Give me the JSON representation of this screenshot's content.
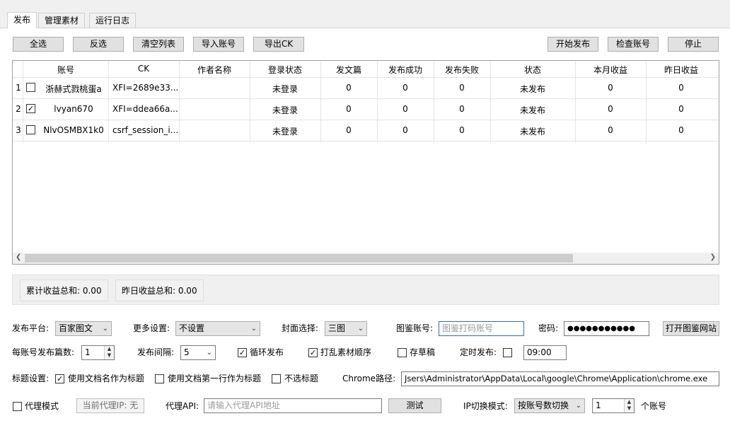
{
  "tabs": [
    {
      "label": "发布"
    },
    {
      "label": "管理素材"
    },
    {
      "label": "运行日志"
    }
  ],
  "toolbar": {
    "select_all": "全选",
    "invert": "反选",
    "clear_list": "清空列表",
    "import_accounts": "导入账号",
    "export_ck": "导出CK",
    "start_publish": "开始发布",
    "check_accounts": "检查账号",
    "stop": "停止"
  },
  "table": {
    "headers": [
      "账号",
      "CK",
      "作者名称",
      "登录状态",
      "发文篇",
      "发布成功",
      "发布失败",
      "状态",
      "本月收益",
      "昨日收益"
    ],
    "rows": [
      {
        "num": "1",
        "checked": false,
        "account": "浙赫式戮桃蛋a",
        "ck": "XFI=2689e33...",
        "author": "",
        "login": "未登录",
        "posts": "0",
        "success": "0",
        "fail": "0",
        "status": "未发布",
        "month": "0",
        "yesterday": "0"
      },
      {
        "num": "2",
        "checked": true,
        "account": "lvyan670",
        "ck": "XFI=ddea66a...",
        "author": "",
        "login": "未登录",
        "posts": "0",
        "success": "0",
        "fail": "0",
        "status": "未发布",
        "month": "0",
        "yesterday": "0"
      },
      {
        "num": "3",
        "checked": false,
        "account": "NlvOSMBX1k0",
        "ck": "csrf_session_i...",
        "author": "",
        "login": "未登录",
        "posts": "0",
        "success": "0",
        "fail": "0",
        "status": "未发布",
        "month": "0",
        "yesterday": "0"
      }
    ]
  },
  "totals": {
    "total_income": "累计收益总和: 0.00",
    "yesterday_income": "昨日收益总和: 0.00"
  },
  "settings": {
    "platform_label": "发布平台:",
    "platform_value": "百家图文",
    "more_label": "更多设置:",
    "more_value": "不设置",
    "cover_label": "封面选择:",
    "cover_value": "三图",
    "tujian_label": "图鉴账号:",
    "tujian_placeholder": "图鉴打码账号",
    "password_label": "密码:",
    "password_value": "●●●●●●●●●●●",
    "open_tujian": "打开图鉴网站",
    "per_account_label": "每账号发布篇数:",
    "per_account_value": "1",
    "interval_label": "发布间隔:",
    "interval_value": "5",
    "loop_label": "循环发布",
    "loop_checked": true,
    "shuffle_label": "打乱素材顺序",
    "shuffle_checked": true,
    "draft_label": "存草稿",
    "draft_checked": false,
    "timed_label": "定时发布:",
    "timed_checked": false,
    "timed_value": "09:00",
    "title_label": "标题设置:",
    "title_opt1": "使用文档名作为标题",
    "title_opt1_checked": true,
    "title_opt2": "使用文档第一行作为标题",
    "title_opt2_checked": false,
    "title_opt3": "不选标题",
    "title_opt3_checked": false,
    "chrome_label": "Chrome路径:",
    "chrome_value": "Jsers\\Administrator\\AppData\\Local\\google\\Chrome\\Application\\chrome.exe",
    "proxy_mode_label": "代理模式",
    "proxy_mode_checked": false,
    "current_proxy": "当前代理IP: 无",
    "proxy_api_label": "代理API:",
    "proxy_api_placeholder": "请输入代理API地址",
    "test_button": "测试",
    "ip_mode_label": "IP切换模式:",
    "ip_mode_value": "按账号数切换",
    "ip_count_value": "1",
    "ip_count_suffix": "个账号"
  }
}
